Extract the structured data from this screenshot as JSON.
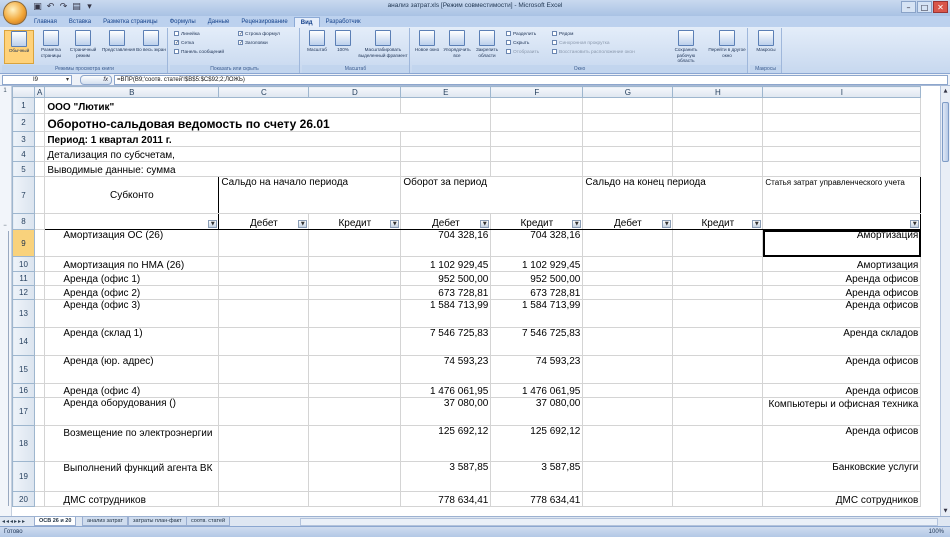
{
  "window": {
    "title": "анализ затрат.xls [Режим совместимости] - Microsoft Excel",
    "controls": [
      "–",
      "□",
      "✕"
    ]
  },
  "ribbon_tabs": [
    "Главная",
    "Вставка",
    "Разметка страницы",
    "Формулы",
    "Данные",
    "Рецензирование",
    "Вид",
    "Разработчик"
  ],
  "active_tab": "Вид",
  "ribbon": {
    "views": {
      "label": "Режимы просмотра книги",
      "normal": "Обычный",
      "page_layout": "Разметка страницы",
      "page_break": "Страничный режим",
      "custom": "Представления",
      "fullscreen": "Во весь экран"
    },
    "show_hide": {
      "label": "Показать или скрыть",
      "ruler": "Линейка",
      "gridlines": "Сетка",
      "messages": "Панель сообщений",
      "formula_bar": "Строка формул",
      "headings": "Заголовки"
    },
    "zoom": {
      "label": "Масштаб",
      "zoom": "Масштаб",
      "hundred": "100%",
      "selection": "Масштабировать выделенный фрагмент"
    },
    "window": {
      "label": "Окно",
      "new": "Новое окно",
      "arrange": "Упорядочить все",
      "freeze": "Закрепить области",
      "split": "Разделить",
      "hide": "Скрыть",
      "unhide": "Отобразить",
      "side_by_side": "Рядом",
      "sync_scroll": "Синхронная прокрутка",
      "reset_pos": "Восстановить расположение окон",
      "save_ws": "Сохранить рабочую область",
      "switch": "Перейти в другое окно"
    },
    "macros": {
      "label": "Макросы",
      "macros": "Макросы"
    }
  },
  "formula_bar": {
    "name_box": "I9",
    "fx": "fx",
    "formula": "=ВПР(B9;'соотв. статей'!$B$5:$C$92;2;ЛОЖЬ)"
  },
  "columns": [
    "A",
    "B",
    "C",
    "D",
    "E",
    "F",
    "G",
    "H",
    "I"
  ],
  "rows": {
    "r1": {
      "num": "1",
      "b": "ООО \"Лютик\""
    },
    "r2": {
      "num": "2",
      "b": "Оборотно-сальдовая ведомость по счету 26.01"
    },
    "r3": {
      "num": "3",
      "b": "Период: 1 квартал 2011 г."
    },
    "r4": {
      "num": "4",
      "b": "Детализация по субсчетам,"
    },
    "r5": {
      "num": "5",
      "b": "Выводимые данные: сумма"
    },
    "r7": {
      "num": "7",
      "b": "Субконто",
      "c": "Сальдо на начало периода",
      "e": "Оборот за период",
      "g": "Сальдо на конец периода",
      "i": "Статья затрат управленческого учета"
    },
    "r8": {
      "num": "8",
      "c": "Дебет",
      "d": "Кредит",
      "e": "Дебет",
      "f": "Кредит",
      "g": "Дебет",
      "h": "Кредит"
    },
    "r9": {
      "num": "9",
      "b": "Амортизация ОС (26)",
      "e": "704 328,16",
      "f": "704 328,16",
      "i": "Амортизация"
    },
    "r10": {
      "num": "10",
      "b": "Амортизация по НМА (26)",
      "e": "1 102 929,45",
      "f": "1 102 929,45",
      "i": "Амортизация"
    },
    "r11": {
      "num": "11",
      "b": "Аренда (офис 1)",
      "e": "952 500,00",
      "f": "952 500,00",
      "i": "Аренда офисов"
    },
    "r12": {
      "num": "12",
      "b": "Аренда (офис 2)",
      "e": "673 728,81",
      "f": "673 728,81",
      "i": "Аренда офисов"
    },
    "r13": {
      "num": "13",
      "b": "Аренда (офис 3)",
      "e": "1 584 713,99",
      "f": "1 584 713,99",
      "i": "Аренда офисов"
    },
    "r14": {
      "num": "14",
      "b": "Аренда (склад 1)",
      "e": "7 546 725,83",
      "f": "7 546 725,83",
      "i": "Аренда складов"
    },
    "r15": {
      "num": "15",
      "b": "Аренда (юр. адрес)",
      "e": "74 593,23",
      "f": "74 593,23",
      "i": "Аренда офисов"
    },
    "r16": {
      "num": "16",
      "b": "Аренда (офис 4)",
      "e": "1 476 061,95",
      "f": "1 476 061,95",
      "i": "Аренда офисов"
    },
    "r17": {
      "num": "17",
      "b": "Аренда оборудования ()",
      "e": "37 080,00",
      "f": "37 080,00",
      "i": "Компьютеры и офисная техника"
    },
    "r18": {
      "num": "18",
      "b": "Возмещение по электроэнергии",
      "e": "125 692,12",
      "f": "125 692,12",
      "i": "Аренда офисов"
    },
    "r19": {
      "num": "19",
      "b": "Выполнений функций агента ВК",
      "e": "3 587,85",
      "f": "3 587,85",
      "i": "Банковские услуги"
    },
    "r20": {
      "num": "20",
      "b": "ДМС сотрудников",
      "e": "778 634,41",
      "f": "778 634,41",
      "i": "ДМС сотрудников"
    }
  },
  "sheet_tabs": [
    "ОСВ 26 и 20",
    "анализ затрат",
    "затраты план-факт",
    "соотв. статей"
  ],
  "active_sheet": "ОСВ 26 и 20",
  "status": {
    "ready": "Готово",
    "zoom": "100%"
  }
}
